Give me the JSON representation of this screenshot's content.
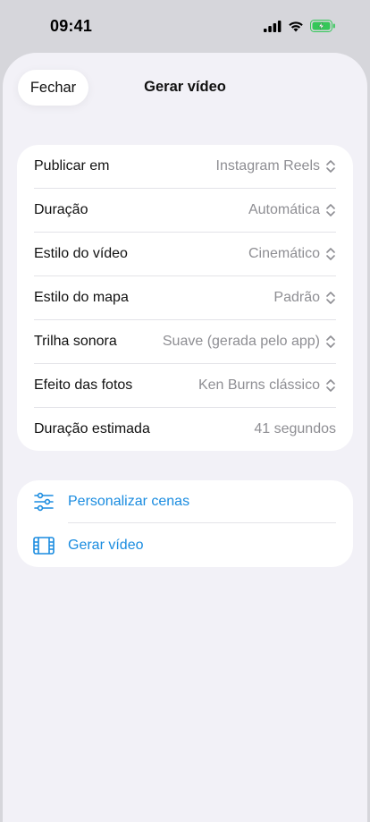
{
  "status_bar": {
    "time": "09:41",
    "icons": [
      "cellular-signal-icon",
      "wifi-icon",
      "battery-charging-icon"
    ],
    "battery_color": "#34c759"
  },
  "header": {
    "close_label": "Fechar",
    "title": "Gerar vídeo"
  },
  "settings": {
    "rows": [
      {
        "label": "Publicar em",
        "value": "Instagram Reels",
        "has_chevron": true
      },
      {
        "label": "Duração",
        "value": "Automática",
        "has_chevron": true
      },
      {
        "label": "Estilo do vídeo",
        "value": "Cinemático",
        "has_chevron": true
      },
      {
        "label": "Estilo do mapa",
        "value": "Padrão",
        "has_chevron": true
      },
      {
        "label": "Trilha sonora",
        "value": "Suave (gerada pelo app)",
        "has_chevron": true
      },
      {
        "label": "Efeito das fotos",
        "value": "Ken Burns clássico",
        "has_chevron": true
      },
      {
        "label": "Duração estimada",
        "value": "41 segundos",
        "has_chevron": false
      }
    ]
  },
  "actions": {
    "items": [
      {
        "label": "Personalizar cenas",
        "icon": "sliders-icon"
      },
      {
        "label": "Gerar vídeo",
        "icon": "film-icon"
      }
    ]
  },
  "colors": {
    "accent": "#1a8ce0",
    "background": "#f2f1f7",
    "secondary_text": "#8e8e93"
  }
}
